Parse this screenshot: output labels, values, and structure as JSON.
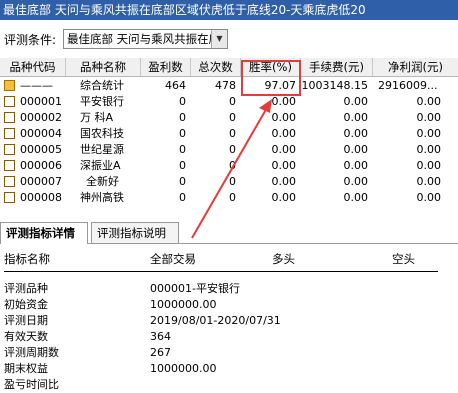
{
  "window": {
    "title": "最佳底部 天问与乘风共振在底部区域伏虎低于底线20-天乘底虎低20"
  },
  "condition": {
    "label": "评测条件:",
    "value": "最佳底部 天问与乘风共振在底"
  },
  "grid": {
    "columns": [
      "品种代码",
      "品种名称",
      "盈利数",
      "总次数",
      "胜率(%)",
      "手续费(元)",
      "净利润(元)"
    ],
    "rows": [
      {
        "code": "———",
        "name": "综合统计",
        "profit": "464",
        "total": "478",
        "winrate": "97.07",
        "fee": "1003148.15",
        "net": "2916009...",
        "special": true
      },
      {
        "code": "000001",
        "name": "平安银行",
        "profit": "0",
        "total": "0",
        "winrate": "0.00",
        "fee": "0.00",
        "net": "0.00"
      },
      {
        "code": "000002",
        "name": "万 科A",
        "profit": "0",
        "total": "0",
        "winrate": "0.00",
        "fee": "0.00",
        "net": "0.00"
      },
      {
        "code": "000004",
        "name": "国农科技",
        "profit": "0",
        "total": "0",
        "winrate": "0.00",
        "fee": "0.00",
        "net": "0.00"
      },
      {
        "code": "000005",
        "name": "世纪星源",
        "profit": "0",
        "total": "0",
        "winrate": "0.00",
        "fee": "0.00",
        "net": "0.00"
      },
      {
        "code": "000006",
        "name": "深振业A",
        "profit": "0",
        "total": "0",
        "winrate": "0.00",
        "fee": "0.00",
        "net": "0.00"
      },
      {
        "code": "000007",
        "name": "全新好",
        "profit": "0",
        "total": "0",
        "winrate": "0.00",
        "fee": "0.00",
        "net": "0.00"
      },
      {
        "code": "000008",
        "name": "神州高铁",
        "profit": "0",
        "total": "0",
        "winrate": "0.00",
        "fee": "0.00",
        "net": "0.00"
      }
    ]
  },
  "tabs": [
    {
      "label": "评测指标详情"
    },
    {
      "label": "评测指标说明"
    }
  ],
  "detail": {
    "headers": [
      "指标名称",
      "全部交易",
      "多头",
      "空头"
    ],
    "rows": [
      {
        "key": "评测品种",
        "value": "000001-平安银行"
      },
      {
        "key": "初始资金",
        "value": "1000000.00"
      },
      {
        "key": "评测日期",
        "value": "2019/08/01-2020/07/31"
      },
      {
        "key": "有效天数",
        "value": "364"
      },
      {
        "key": "评测周期数",
        "value": "267"
      },
      {
        "key": "期末权益",
        "value": "1000000.00"
      },
      {
        "key": "盈亏时间比",
        "value": ""
      }
    ]
  },
  "colors": {
    "titlebar": "#2f5fa8",
    "highlight": "#e53b3b"
  }
}
